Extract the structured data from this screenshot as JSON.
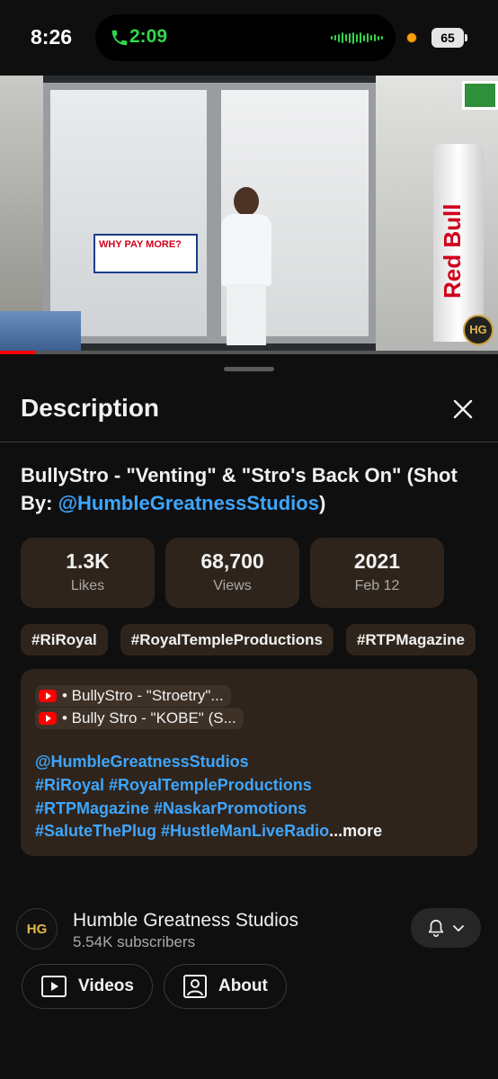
{
  "status_bar": {
    "time": "8:26",
    "call_duration": "2:09",
    "battery": "65",
    "call_color": "#32d74b"
  },
  "video_player": {
    "progress_fraction": 0.07,
    "progress_color": "#ff0000",
    "overlay_sign_text": "WHY PAY MORE?",
    "fridge_brand": "Red Bull"
  },
  "description_sheet": {
    "title": "Description",
    "close_icon": "close-icon"
  },
  "video": {
    "title": "BullyStro - \"Venting\" & \"Stro's Back On\" (Shot By: ",
    "title_link": "@HumbleGreatnessStudios",
    "title_end": ")",
    "stats": [
      {
        "value": "1.3K",
        "label": "Likes"
      },
      {
        "value": "68,700",
        "label": "Views"
      },
      {
        "value": "2021",
        "label": "Feb 12"
      }
    ],
    "tags": [
      "#RiRoyal",
      "#RoyalTempleProductions",
      "#RTPMagazine"
    ],
    "linked_videos": [
      "• BullyStro - \"Stroetry\"...",
      "• Bully Stro - \"KOBE\" (S..."
    ],
    "description_lines": [
      "@HumbleGreatnessStudios",
      "#RiRoyal #RoyalTempleProductions",
      "#RTPMagazine #NaskarPromotions"
    ],
    "description_last_line": "#SaluteThePlug #HustleManLiveRadio",
    "more_label": "...more"
  },
  "channel": {
    "name": "Humble Greatness Studios",
    "subscribers": "5.54K subscribers",
    "avatar_text": "HG",
    "buttons": [
      {
        "label": "Videos",
        "icon": "play-box-icon"
      },
      {
        "label": "About",
        "icon": "person-box-icon"
      }
    ]
  },
  "colors": {
    "background": "#0f0f0f",
    "card": "#2f241b",
    "link": "#3ea6ff"
  }
}
